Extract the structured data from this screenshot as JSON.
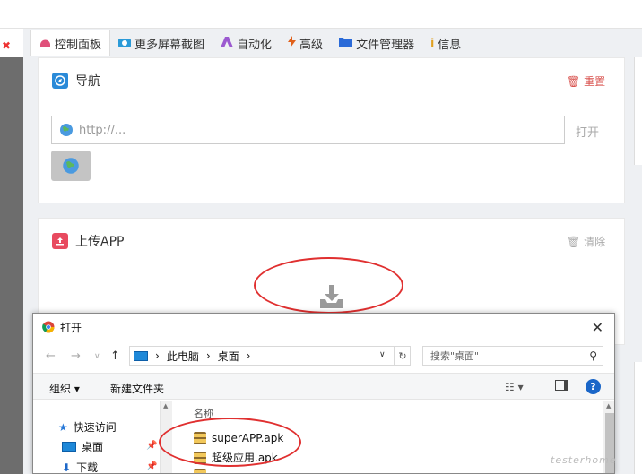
{
  "tabs": [
    {
      "icon": "dashboard-icon",
      "label": "控制面板",
      "color": "#e0507a"
    },
    {
      "icon": "camera-icon",
      "label": "更多屏幕截图",
      "color": "#2a9ad8"
    },
    {
      "icon": "automation-icon",
      "label": "自动化",
      "color": "#9b59d0"
    },
    {
      "icon": "bolt-icon",
      "label": "高级",
      "color": "#e0601a"
    },
    {
      "icon": "folder-icon",
      "label": "文件管理器",
      "color": "#2a6ad8"
    },
    {
      "icon": "info-icon",
      "label": "信息",
      "color": "#e0a020"
    }
  ],
  "nav_panel": {
    "title": "导航",
    "reset_label": "重置",
    "url_placeholder": "http://...",
    "open_label": "打开"
  },
  "upload_panel": {
    "title": "上传APP",
    "clear_label": "清除"
  },
  "dialog": {
    "title": "打开",
    "path": [
      "此电脑",
      "桌面"
    ],
    "search_placeholder": "搜索\"桌面\"",
    "organize_label": "组织",
    "new_folder_label": "新建文件夹",
    "help_label": "?",
    "nav_items": [
      {
        "icon": "star-icon",
        "label": "快速访问",
        "pinned": false
      },
      {
        "icon": "desktop-icon",
        "label": "桌面",
        "pinned": true
      },
      {
        "icon": "download-icon",
        "label": "下载",
        "pinned": true
      }
    ],
    "column_header": "名称",
    "files": [
      {
        "name": "superAPP.apk"
      },
      {
        "name": "超级应用.apk"
      }
    ]
  },
  "watermark": "testerhome",
  "colors": {
    "accent_red": "#d9534f",
    "annotation": "#e03030",
    "nav_icon": "#2a8ad8",
    "upload_icon": "#e84a5f"
  }
}
